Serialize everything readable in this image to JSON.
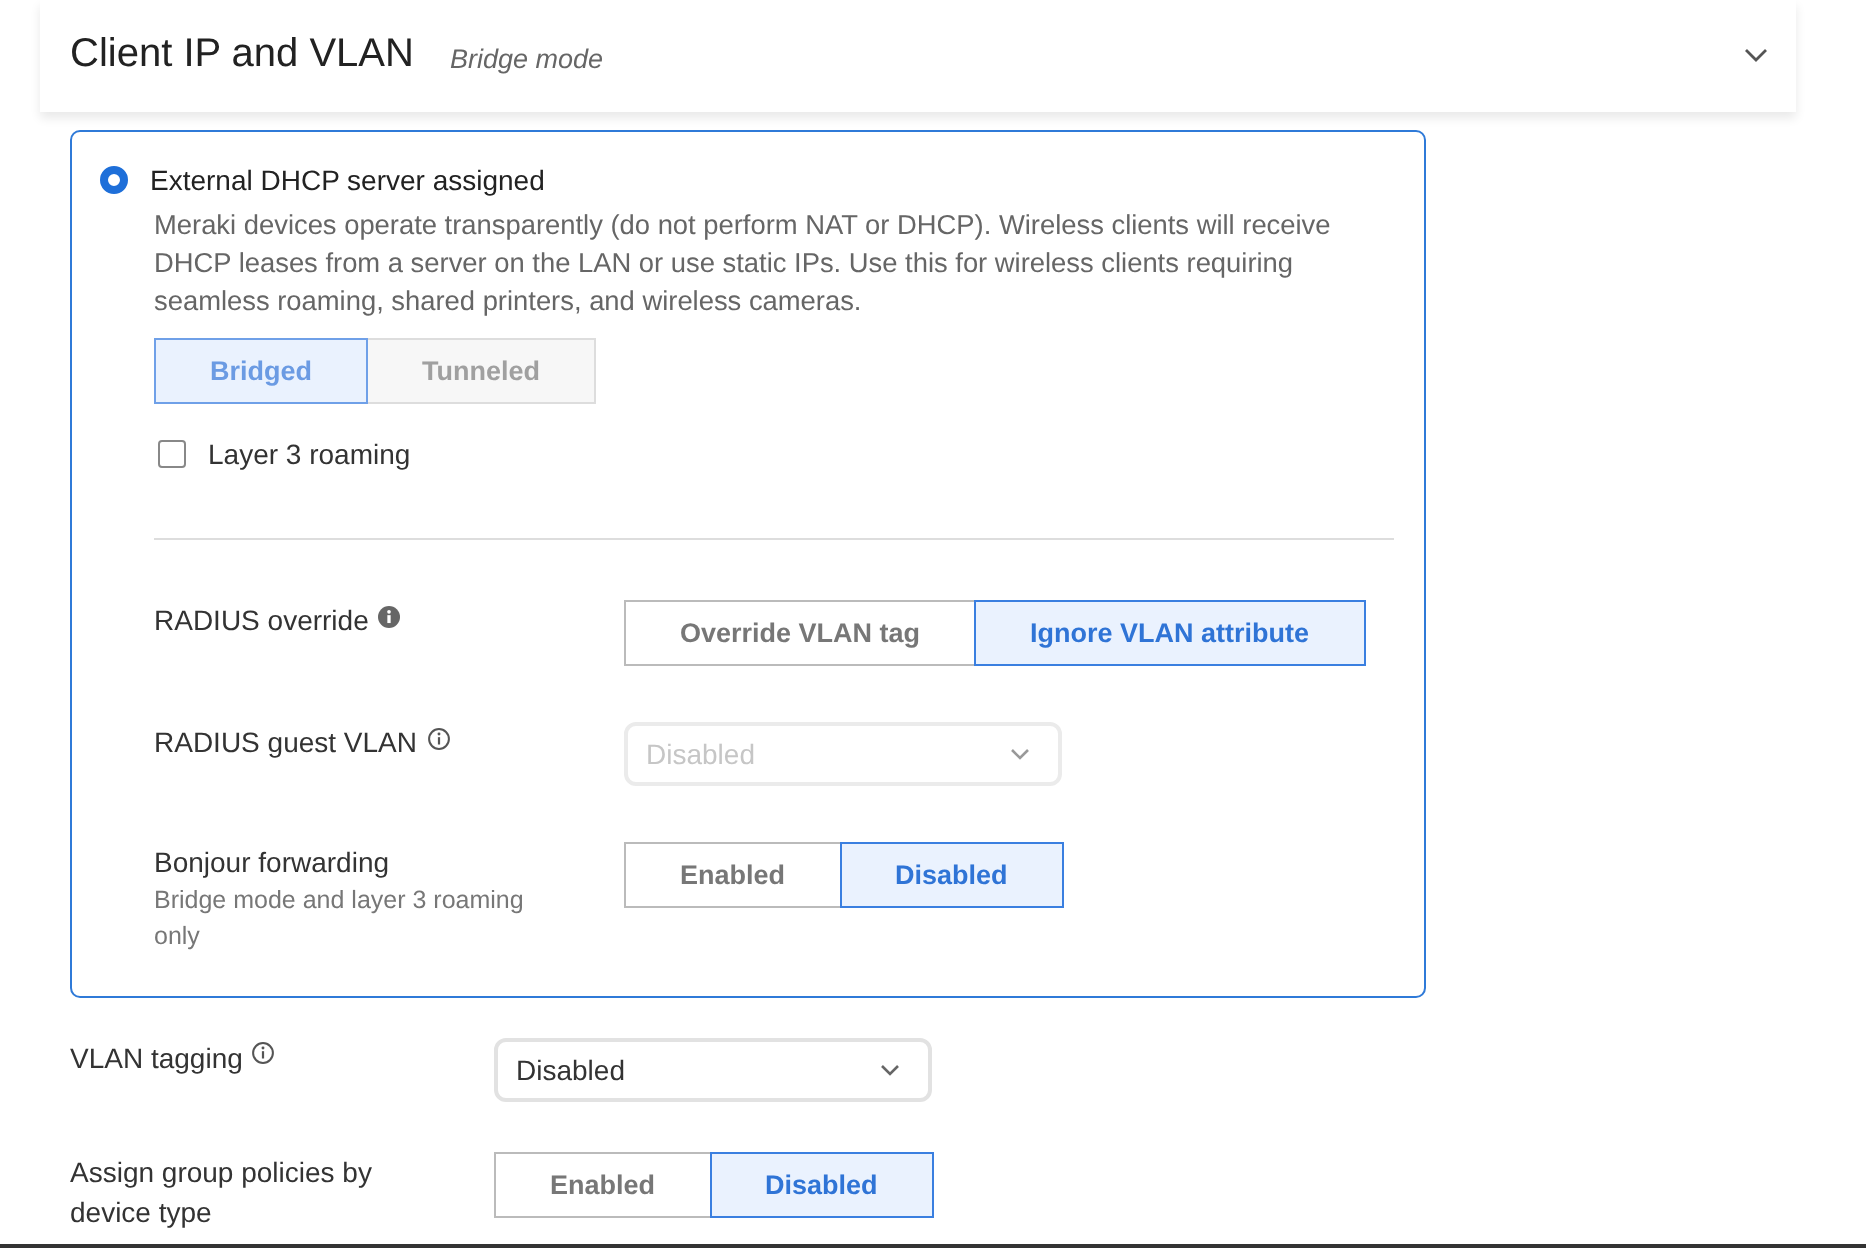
{
  "header": {
    "title": "Client IP and VLAN",
    "subtitle": "Bridge mode"
  },
  "addressing": {
    "option": {
      "label": "External DHCP server assigned",
      "selected": true,
      "description": "Meraki devices operate transparently (do not perform NAT or DHCP). Wireless clients will receive DHCP leases from a server on the LAN or use static IPs. Use this for wireless clients requiring seamless roaming, shared printers, and wireless cameras."
    },
    "mode": {
      "disabled": true,
      "options": [
        {
          "label": "Bridged",
          "selected": true
        },
        {
          "label": "Tunneled",
          "selected": false
        }
      ]
    },
    "layer3_roaming": {
      "label": "Layer 3 roaming",
      "checked": false
    },
    "settings": [
      {
        "kind": "segmented",
        "label": "RADIUS override",
        "info": {
          "kind": "filled"
        },
        "options": [
          {
            "label": "Override VLAN tag",
            "selected": false
          },
          {
            "label": "Ignore VLAN attribute",
            "selected": true
          }
        ]
      },
      {
        "kind": "select",
        "label": "RADIUS guest VLAN",
        "info": {
          "kind": "outline"
        },
        "value": "Disabled",
        "disabled": true
      },
      {
        "kind": "segmented",
        "label": "Bonjour forwarding",
        "hint": "Bridge mode and layer 3 roaming only",
        "options": [
          {
            "label": "Enabled",
            "selected": false
          },
          {
            "label": "Disabled",
            "selected": true
          }
        ]
      }
    ]
  },
  "settings": [
    {
      "kind": "select",
      "label": "VLAN tagging",
      "info": {
        "kind": "outline"
      },
      "value": "Disabled",
      "disabled": false
    },
    {
      "kind": "segmented",
      "label": "Assign group policies by device type",
      "options": [
        {
          "label": "Enabled",
          "selected": false
        },
        {
          "label": "Disabled",
          "selected": true
        }
      ]
    }
  ]
}
